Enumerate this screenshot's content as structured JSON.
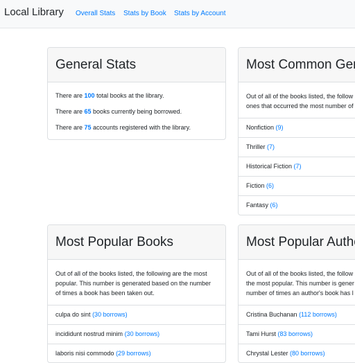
{
  "navbar": {
    "brand": "Local Library",
    "links": [
      "Overall Stats",
      "Stats by Book",
      "Stats by Account"
    ]
  },
  "general_stats": {
    "title": "General Stats",
    "lines": [
      {
        "pre": "There are ",
        "value": "100",
        "post": " total books at the library."
      },
      {
        "pre": "There are ",
        "value": "65",
        "post": " books currently being borrowed."
      },
      {
        "pre": "There are ",
        "value": "75",
        "post": " accounts registered with the library."
      }
    ]
  },
  "common_genres": {
    "title": "Most Common Gen",
    "desc": [
      "Out of all of the books listed, the follow",
      "ones that occurred the most number of"
    ],
    "items": [
      {
        "name": "Nonfiction",
        "count": "(9)"
      },
      {
        "name": "Thriller",
        "count": "(7)"
      },
      {
        "name": "Historical Fiction",
        "count": "(7)"
      },
      {
        "name": "Fiction",
        "count": "(6)"
      },
      {
        "name": "Fantasy",
        "count": "(6)"
      }
    ]
  },
  "popular_books": {
    "title": "Most Popular Books",
    "desc": [
      "Out of all of the books listed, the following are the most",
      "popular. This number is generated based on the number",
      "of times a book has been taken out."
    ],
    "items": [
      {
        "name": "culpa do sint",
        "count": "(30 borrows)"
      },
      {
        "name": "incididunt nostrud minim",
        "count": "(30 borrows)"
      },
      {
        "name": "laboris nisi commodo",
        "count": "(29 borrows)"
      }
    ]
  },
  "popular_authors": {
    "title": "Most Popular Autho",
    "desc": [
      "Out of all of the books listed, the follow",
      "the most popular. This number is gener",
      "number of times an author's book has l"
    ],
    "items": [
      {
        "name": "Cristina Buchanan",
        "count": "(112 borrows)"
      },
      {
        "name": "Tami Hurst",
        "count": "(83 borrows)"
      },
      {
        "name": "Chrystal Lester",
        "count": "(80 borrows)"
      }
    ]
  }
}
